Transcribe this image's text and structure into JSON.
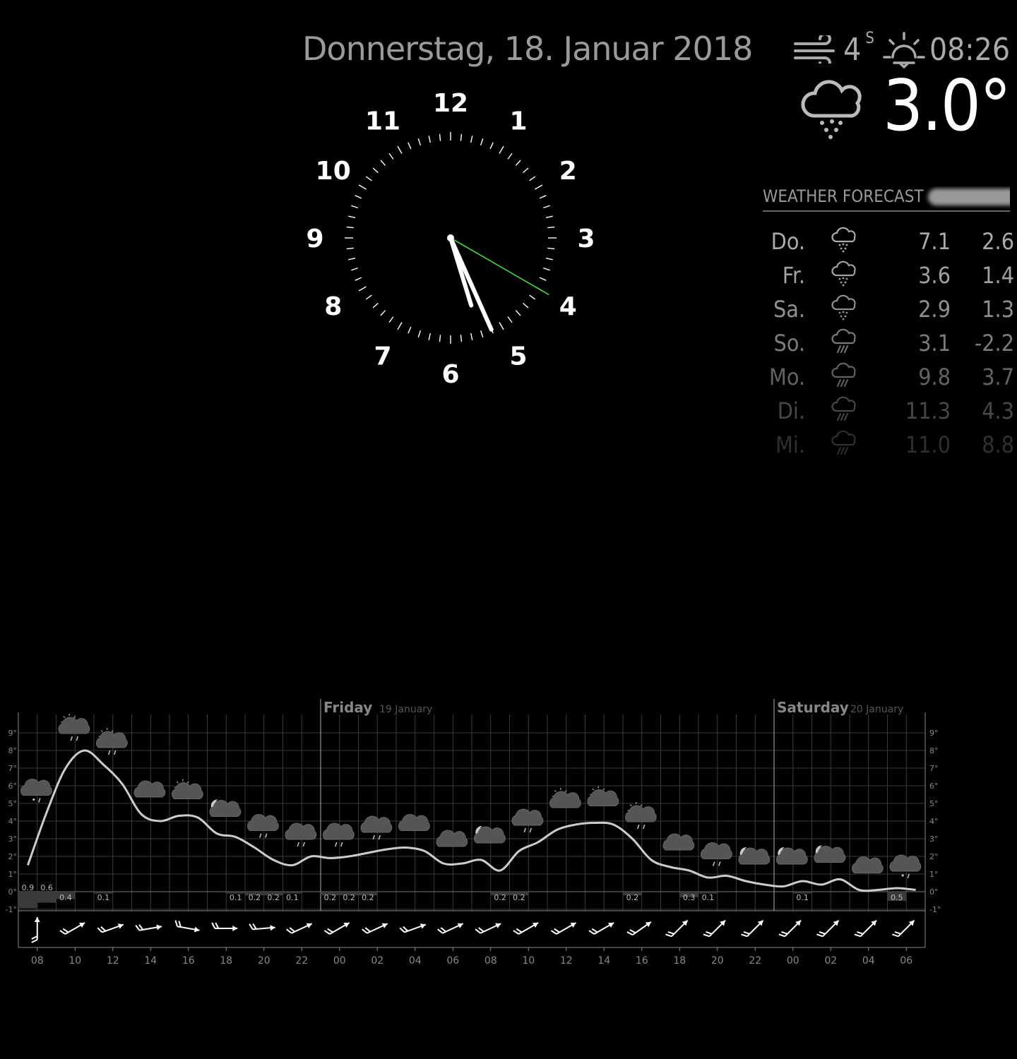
{
  "header": {
    "date": "Donnerstag, 18. Januar 2018"
  },
  "clock": {
    "numbers": [
      "12",
      "1",
      "2",
      "3",
      "4",
      "5",
      "6",
      "7",
      "8",
      "9",
      "10",
      "11"
    ],
    "hour": 5,
    "minute": 26,
    "second": 20,
    "second_hand_color": "#3fd43f"
  },
  "current_weather": {
    "wind_icon": "wind-icon",
    "wind_speed": "4",
    "wind_direction": "S",
    "sun_icon": "sunrise-icon",
    "sunrise_time": "08:26",
    "condition_icon": "sleet-cloud-icon",
    "temperature": "3.0°"
  },
  "forecast": {
    "title": "WEATHER FORECAST",
    "rows": [
      {
        "day": "Do.",
        "icon": "snow-icon",
        "max": "7.1",
        "min": "2.6",
        "opacity": 1.0
      },
      {
        "day": "Fr.",
        "icon": "snow-icon",
        "max": "3.6",
        "min": "1.4",
        "opacity": 0.95
      },
      {
        "day": "Sa.",
        "icon": "snow-icon",
        "max": "2.9",
        "min": "1.3",
        "opacity": 0.85
      },
      {
        "day": "So.",
        "icon": "rain-icon",
        "max": "3.1",
        "min": "-2.2",
        "opacity": 0.72
      },
      {
        "day": "Mo.",
        "icon": "rain-icon",
        "max": "9.8",
        "min": "3.7",
        "opacity": 0.58
      },
      {
        "day": "Di.",
        "icon": "rain-icon",
        "max": "11.3",
        "min": "4.3",
        "opacity": 0.42
      },
      {
        "day": "Mi.",
        "icon": "rain-icon",
        "max": "11.0",
        "min": "8.8",
        "opacity": 0.28
      }
    ]
  },
  "meteogram": {
    "day_labels": [
      {
        "name": "Friday",
        "date": "19 January",
        "hour_index": 16
      },
      {
        "name": "Saturday",
        "date": "20 January",
        "hour_index": 40
      }
    ],
    "y_ticks": [
      "-1°",
      "0°",
      "1°",
      "2°",
      "3°",
      "4°",
      "5°",
      "6°",
      "7°",
      "8°",
      "9°"
    ],
    "x_labels": [
      "08",
      "10",
      "12",
      "14",
      "16",
      "18",
      "20",
      "22",
      "00",
      "02",
      "04",
      "06",
      "08",
      "10",
      "12",
      "14",
      "16",
      "18",
      "20",
      "22",
      "00",
      "02",
      "04",
      "06"
    ],
    "chart_data": {
      "type": "line",
      "x_unit": "hour",
      "temperature": [
        1.5,
        4.5,
        7.0,
        8.0,
        7.2,
        6.1,
        4.4,
        4.0,
        4.3,
        4.2,
        3.3,
        3.1,
        2.5,
        1.8,
        1.5,
        2.0,
        1.9,
        2.0,
        2.2,
        2.4,
        2.5,
        2.3,
        1.6,
        1.6,
        1.8,
        1.2,
        2.3,
        2.8,
        3.5,
        3.8,
        3.9,
        3.8,
        3.0,
        1.8,
        1.4,
        1.2,
        0.8,
        0.9,
        0.6,
        0.4,
        0.3,
        0.6,
        0.4,
        0.7,
        0.1,
        0.1,
        0.2,
        0.1
      ],
      "precipitation": [
        {
          "i": 0,
          "label": "0.9"
        },
        {
          "i": 1,
          "label": "0.6"
        },
        {
          "i": 2,
          "label": "0.4"
        },
        {
          "i": 4,
          "label": "0.1"
        },
        {
          "i": 11,
          "label": "0.1"
        },
        {
          "i": 12,
          "label": "0.2"
        },
        {
          "i": 13,
          "label": "0.2"
        },
        {
          "i": 14,
          "label": "0.1"
        },
        {
          "i": 16,
          "label": "0.2"
        },
        {
          "i": 17,
          "label": "0.2"
        },
        {
          "i": 18,
          "label": "0.2"
        },
        {
          "i": 25,
          "label": "0.2"
        },
        {
          "i": 26,
          "label": "0.2"
        },
        {
          "i": 32,
          "label": "0.2"
        },
        {
          "i": 35,
          "label": "0.3"
        },
        {
          "i": 36,
          "label": "0.1"
        },
        {
          "i": 41,
          "label": "0.1"
        },
        {
          "i": 46,
          "label": "0.5"
        }
      ],
      "weather_symbols": [
        "sleet-cloud",
        "sun-cloud-rain",
        "sun-cloud-rain",
        "cloud",
        "sun-cloud",
        "moon-cloud",
        "cloud-rain",
        "cloud-rain",
        "cloud-rain",
        "cloud-rain",
        "cloud",
        "cloud",
        "moon-cloud",
        "cloud-rain",
        "sun-cloud",
        "sun-cloud",
        "sun-cloud-rain",
        "cloud",
        "cloud-rain",
        "moon-cloud",
        "moon-cloud",
        "moon-cloud",
        "cloud",
        "sleet-cloud"
      ],
      "wind_directions_deg": [
        0,
        60,
        70,
        80,
        100,
        90,
        85,
        65,
        60,
        65,
        70,
        65,
        65,
        60,
        60,
        60,
        55,
        45,
        45,
        45,
        45,
        45,
        45,
        45
      ],
      "ylim": [
        -1,
        9
      ]
    }
  }
}
